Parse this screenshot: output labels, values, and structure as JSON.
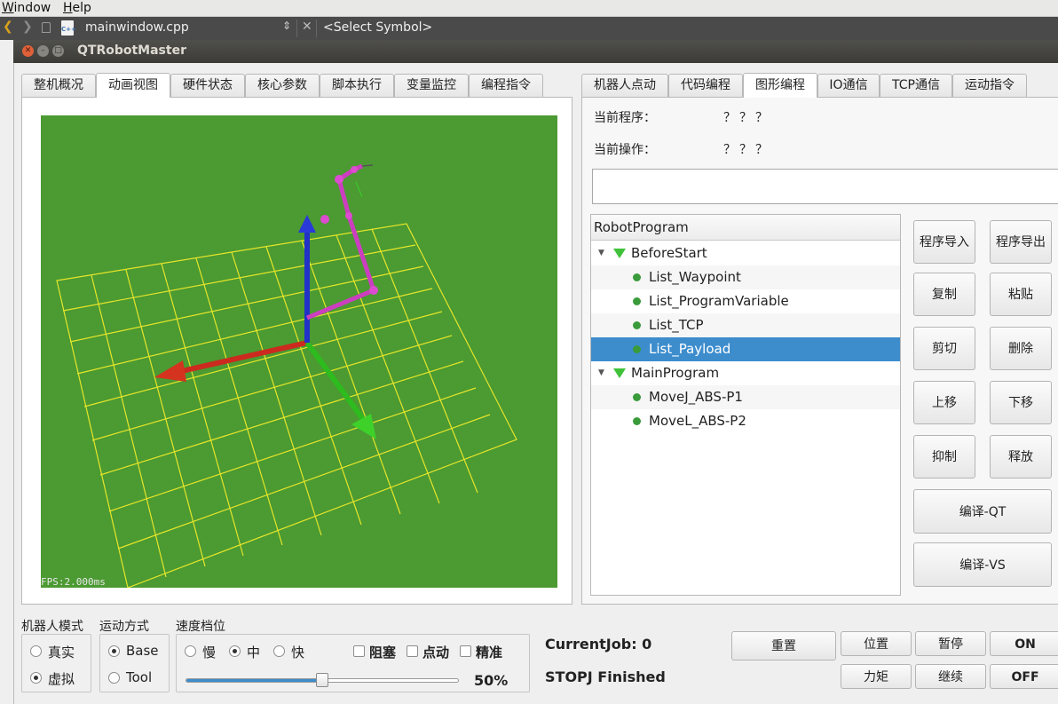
{
  "ide": {
    "menu": [
      "Window",
      "Help"
    ],
    "file_icon_text": "C++",
    "file_name": "mainwindow.cpp",
    "symbol_selector": "<Select Symbol>",
    "updown_glyph": "⇕",
    "close_glyph": "✕"
  },
  "window": {
    "title": "QTRobotMaster"
  },
  "left_tabs": [
    "整机概况",
    "动画视图",
    "硬件状态",
    "核心参数",
    "脚本执行",
    "变量监控",
    "编程指令"
  ],
  "left_active_tab": 1,
  "view3d": {
    "fps_text": "FPS:2.000ms",
    "background_color": "#4b9a32",
    "grid_color": "#e6e62a"
  },
  "right_tabs": [
    "机器人点动",
    "代码编程",
    "图形编程",
    "IO通信",
    "TCP通信",
    "运动指令"
  ],
  "right_active_tab": 2,
  "info": {
    "current_program_label": "当前程序：",
    "current_program_value": "？？？",
    "current_op_label": "当前操作：",
    "current_op_value": "？？？"
  },
  "tree": {
    "header": "RobotProgram",
    "rows": [
      {
        "text": "BeforeStart",
        "kind": "group"
      },
      {
        "text": "List_Waypoint",
        "kind": "item"
      },
      {
        "text": "List_ProgramVariable",
        "kind": "item"
      },
      {
        "text": "List_TCP",
        "kind": "item"
      },
      {
        "text": "List_Payload",
        "kind": "item",
        "selected": true
      },
      {
        "text": "MainProgram",
        "kind": "group"
      },
      {
        "text": "MoveJ_ABS-P1",
        "kind": "item"
      },
      {
        "text": "MoveL_ABS-P2",
        "kind": "item"
      }
    ]
  },
  "program_buttons": {
    "import": "程序导入",
    "export": "程序导出",
    "copy": "复制",
    "paste": "粘贴",
    "cut": "剪切",
    "delete": "删除",
    "move_up": "上移",
    "move_down": "下移",
    "suppress": "抑制",
    "release": "释放",
    "compile_qt": "编译-QT",
    "compile_vs": "编译-VS"
  },
  "robot_mode": {
    "title": "机器人模式",
    "options": [
      "真实",
      "虚拟"
    ],
    "selected": "虚拟"
  },
  "motion_mode": {
    "title": "运动方式",
    "options": [
      "Base",
      "Tool"
    ],
    "selected": "Base"
  },
  "speed": {
    "title": "速度档位",
    "options": [
      "慢",
      "中",
      "快"
    ],
    "selected": "中",
    "checks": [
      "阻塞",
      "点动",
      "精准"
    ],
    "value": 0.5,
    "value_text": "50%"
  },
  "status": {
    "current_job": "CurrentJob:  0",
    "message": "STOPJ Finished"
  },
  "control_buttons": {
    "reset": "重置",
    "position": "位置",
    "pause": "暂停",
    "on": "ON",
    "torque": "力矩",
    "continue": "继续",
    "off": "OFF"
  }
}
